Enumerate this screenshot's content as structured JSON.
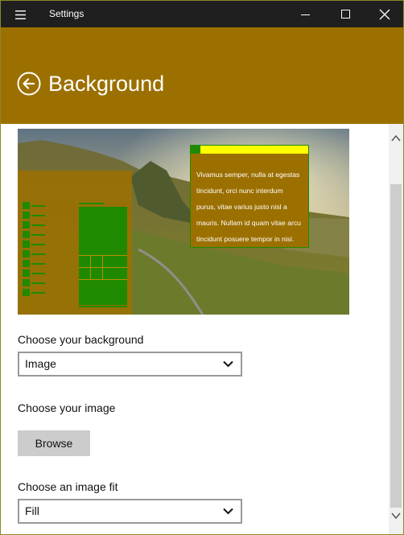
{
  "window": {
    "title": "Settings"
  },
  "header": {
    "title": "Background"
  },
  "preview": {
    "notification_lines": [
      "Vivamus semper, nulla at egestas",
      "tincidunt, orci nunc interdum",
      "purus, vitae varius justo nisl a",
      "mauris. Nullam id quam vitae arcu",
      "tincidunt posuere tempor in nisi."
    ]
  },
  "form": {
    "background_label": "Choose your background",
    "background_value": "Image",
    "image_label": "Choose your image",
    "browse_label": "Browse",
    "fit_label": "Choose an image fit",
    "fit_value": "Fill"
  },
  "colors": {
    "accent": "#9c7000",
    "tile_green": "#1f8a00",
    "notification_bar": "#ffff00",
    "titlebar": "#1f1f1f"
  }
}
